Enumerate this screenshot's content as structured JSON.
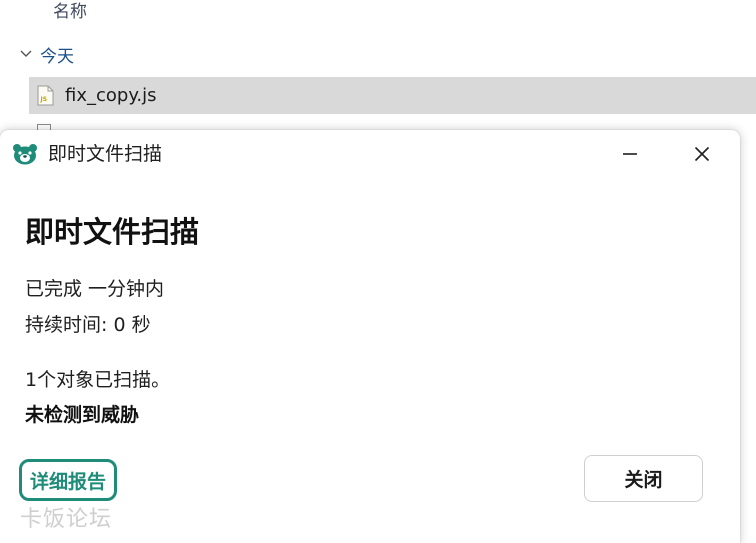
{
  "explorer": {
    "column_header": "名称",
    "group_label": "今天",
    "file": {
      "name": "fix_copy.js",
      "icon": "javascript-file-icon",
      "icon_badge": "JS"
    },
    "selected_row_color": "#d9d9d9",
    "group_label_color": "#1a4f8a"
  },
  "dialog": {
    "title": "即时文件扫描",
    "heading": "即时文件扫描",
    "completed": "已完成 一分钟内",
    "duration": "持续时间: 0 秒",
    "objects_scanned": "1个对象已扫描。",
    "threat_status": "未检测到威胁",
    "report_button": "详细报告",
    "close_button": "关闭",
    "accent_color": "#1e8c79",
    "icons": {
      "logo": "app-logo-icon",
      "minimize": "minimize-icon",
      "close": "close-icon"
    }
  },
  "watermark": "卡饭论坛"
}
